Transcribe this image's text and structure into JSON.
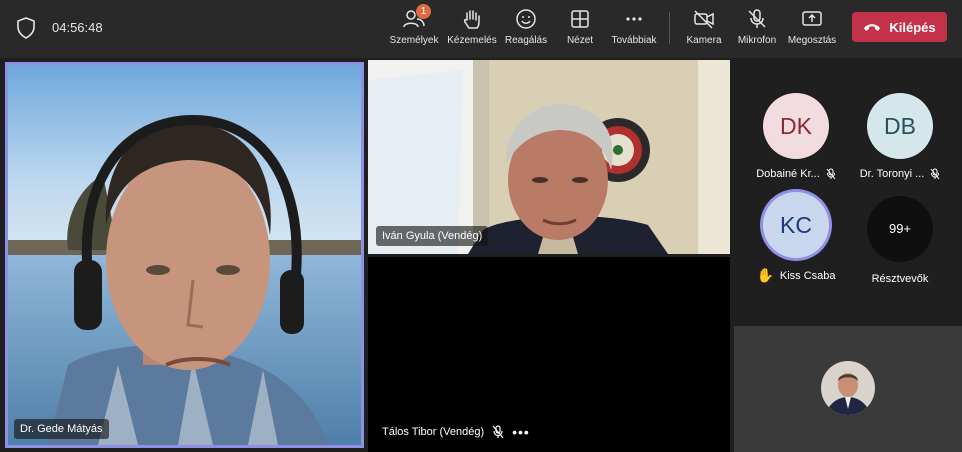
{
  "meeting": {
    "time": "04:56:48"
  },
  "toolbar": {
    "people_label": "Személyek",
    "people_badge": "1",
    "raise_hand_label": "Kézemelés",
    "react_label": "Reagálás",
    "view_label": "Nézet",
    "more_label": "Továbbiak",
    "camera_label": "Kamera",
    "mic_label": "Mikrofon",
    "share_label": "Megosztás",
    "leave_label": "Kilépés"
  },
  "videos": {
    "gede": {
      "name": "Dr. Gede Mátyás"
    },
    "ivan": {
      "name": "Iván Gyula (Vendég)"
    },
    "talos": {
      "name": "Tálos Tibor (Vendég)"
    }
  },
  "roster": [
    {
      "initials": "DK",
      "name": "Dobainé Kr...",
      "avatar_bg": "#f3dcdf",
      "avatar_fg": "#8a2a36",
      "muted": true
    },
    {
      "initials": "DB",
      "name": "Dr. Toronyi ...",
      "avatar_bg": "#d6e7ec",
      "avatar_fg": "#28505e",
      "muted": true
    },
    {
      "initials": "KC",
      "name": "Kiss Csaba",
      "avatar_bg": "#c8d6ee",
      "avatar_fg": "#1d3a78",
      "hand_raised": true
    },
    {
      "initials": "99+",
      "name": "Résztvevők",
      "avatar_bg": "#0f0f0f",
      "avatar_fg": "#ffffff"
    }
  ],
  "colors": {
    "accent": "#8f8fe8",
    "leave": "#c4314b",
    "badge": "#e06b42"
  }
}
